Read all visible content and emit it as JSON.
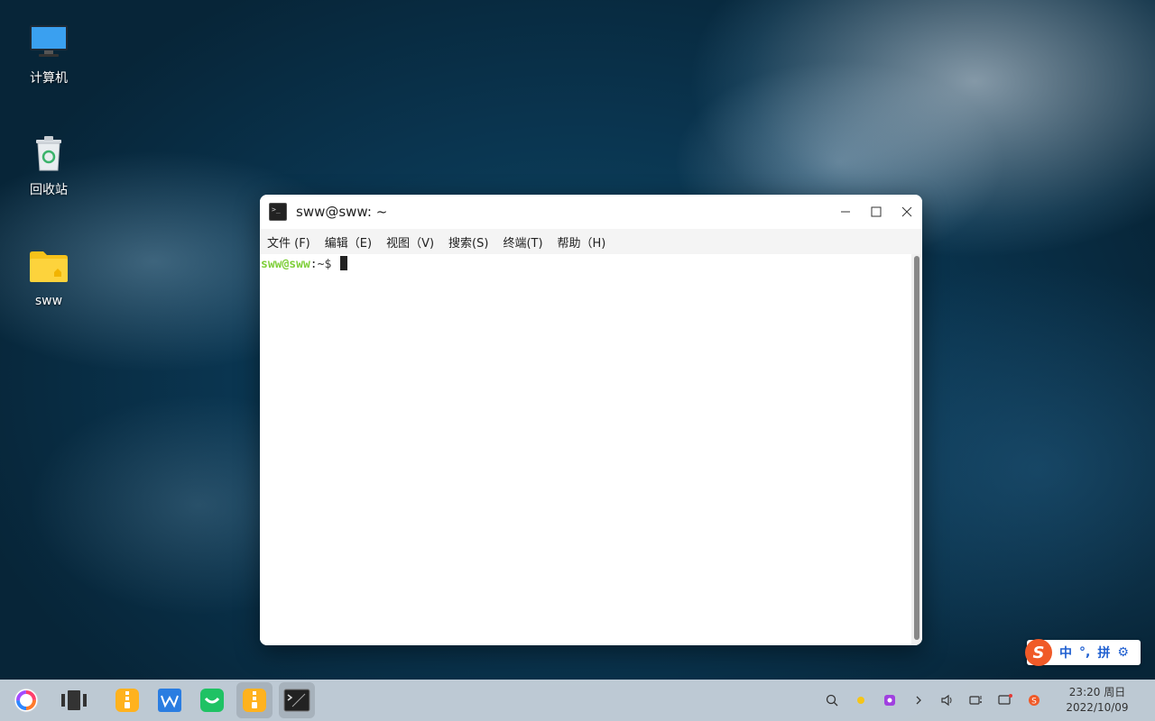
{
  "desktop": {
    "icons": [
      {
        "label": "计算机",
        "icon": "computer-icon"
      },
      {
        "label": "回收站",
        "icon": "trash-icon"
      },
      {
        "label": "sww",
        "icon": "home-folder-icon"
      }
    ]
  },
  "terminal": {
    "title": "sww@sww: ~",
    "menus": [
      "文件 (F)",
      "编辑（E)",
      "视图（V)",
      "搜索(S)",
      "终端(T)",
      "帮助（H)"
    ],
    "prompt_user": "sww@sww",
    "prompt_path": ":~$ "
  },
  "ime": {
    "logo": "S",
    "mode": "中",
    "punct": "°,",
    "layout": "拼",
    "settings_icon": "gear-icon"
  },
  "taskbar": {
    "apps": [
      "start-menu-icon",
      "multitasking-icon",
      "archive-app-icon",
      "wps-icon",
      "wechat-icon",
      "archive-app-icon",
      "terminal-icon"
    ],
    "clock_time": "23:20 周日",
    "clock_date": "2022/10/09"
  },
  "colors": {
    "prompt_green": "#7fcf3b",
    "ime_blue": "#1f5fd0",
    "sogou_orange": "#f05a28"
  }
}
